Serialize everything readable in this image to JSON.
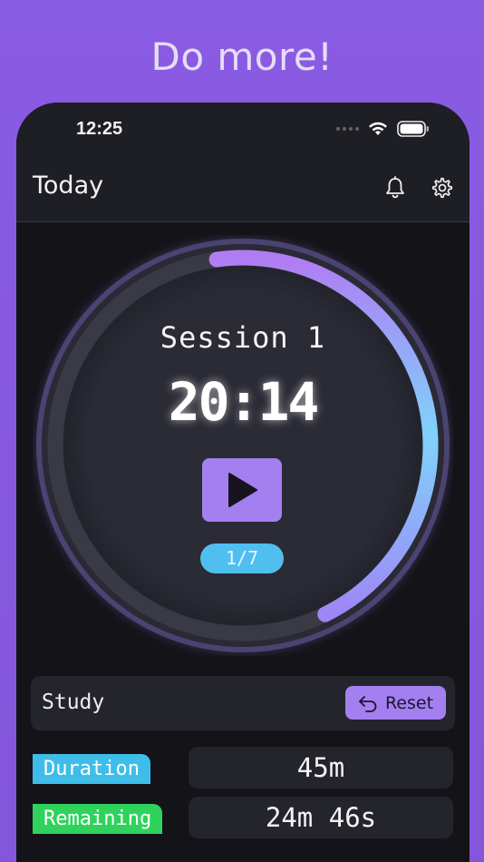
{
  "headline": "Do more!",
  "status_bar": {
    "time": "12:25"
  },
  "nav": {
    "title": "Today",
    "bell_icon": "bell-icon",
    "settings_icon": "gear-icon"
  },
  "timer": {
    "session_label": "Session 1",
    "time": "20:14",
    "counter": "1/7",
    "progress": 0.45,
    "play_icon": "play-icon"
  },
  "study": {
    "label": "Study",
    "reset_label": "Reset",
    "reset_icon": "undo-arrow-icon"
  },
  "stats": [
    {
      "label": "Duration",
      "value": "45m",
      "color": "#3fbde9"
    },
    {
      "label": "Remaining",
      "value": "24m 46s",
      "color": "#2fd35c"
    }
  ],
  "colors": {
    "accent": "#a47ff0",
    "ring_start": "#b07cf3",
    "ring_end": "#7fd2fb",
    "background": "#8a5ae0"
  }
}
